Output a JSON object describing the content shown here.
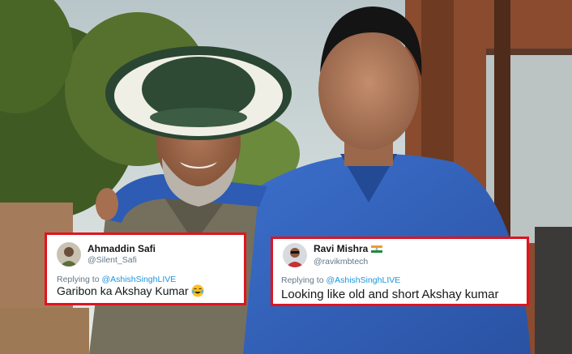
{
  "photo": {
    "icon": "two-men-outdoor-photo",
    "colors": {
      "sky": "#c8d3d6",
      "trees": "#4f6a2c",
      "shirt_blue": "#2f5fb8",
      "hat": "#2e4a34"
    }
  },
  "tweets": [
    {
      "name": "Ahmaddin Safi",
      "handle": "@Silent_Safi",
      "reply_prefix": "Replying to ",
      "reply_to": "@AshishSinghLIVE",
      "text": "Garibon ka Akshay Kumar",
      "emoji": "laughing-tears-emoji"
    },
    {
      "name": "Ravi Mishra",
      "name_badge": "india-flag-icon",
      "handle": "@ravikmbtech",
      "reply_prefix": "Replying to ",
      "reply_to": "@AshishSinghLIVE",
      "text": "Looking like old and short Akshay kumar"
    }
  ],
  "colors": {
    "card_border": "#e0141e",
    "mention": "#1b95e0",
    "secondary_text": "#657786",
    "primary_text": "#14171a"
  }
}
